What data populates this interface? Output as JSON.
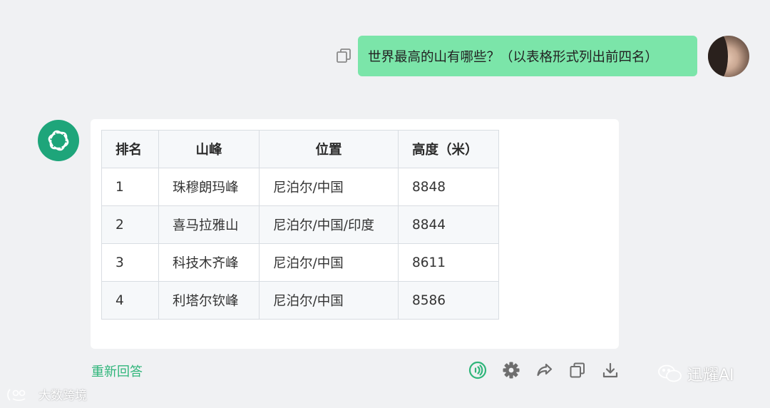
{
  "user_message": {
    "text": "世界最高的山有哪些？（以表格形式列出前四名）",
    "copy_icon": "copy-icon",
    "avatar": "user-avatar"
  },
  "assistant": {
    "avatar_icon": "openai-logo-icon",
    "table": {
      "headers": [
        "排名",
        "山峰",
        "位置",
        "高度（米）"
      ],
      "rows": [
        [
          "1",
          "珠穆朗玛峰",
          "尼泊尔/中国",
          "8848"
        ],
        [
          "2",
          "喜马拉雅山",
          "尼泊尔/中国/印度",
          "8844"
        ],
        [
          "3",
          "科技木齐峰",
          "尼泊尔/中国",
          "8611"
        ],
        [
          "4",
          "利塔尔钦峰",
          "尼泊尔/中国",
          "8586"
        ]
      ]
    }
  },
  "footer": {
    "regenerate_label": "重新回答",
    "actions": [
      "speaker-icon",
      "gear-icon",
      "share-icon",
      "copy-icon",
      "download-icon"
    ],
    "accent": "#2fb57a"
  },
  "watermarks": {
    "left": "大数跨境",
    "right": "迅耀AI"
  },
  "colors": {
    "background": "#f0f1f3",
    "user_bubble": "#7be5a9",
    "bot_avatar": "#1ea57a",
    "card": "#ffffff"
  }
}
